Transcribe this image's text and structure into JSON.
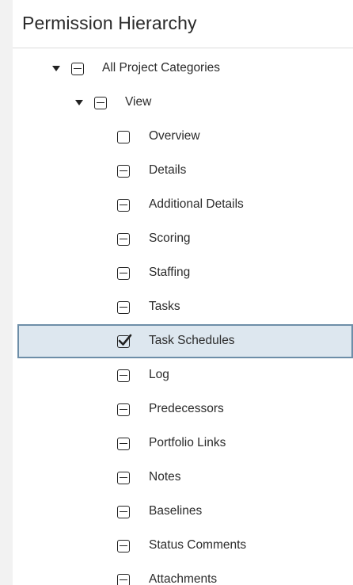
{
  "header": {
    "title": "Permission Hierarchy"
  },
  "tree": {
    "root": {
      "label": "All Project Categories",
      "state": "partial",
      "expanded": true
    },
    "group": {
      "label": "View",
      "state": "partial",
      "expanded": true
    },
    "items": [
      {
        "label": "Overview",
        "state": "unchecked"
      },
      {
        "label": "Details",
        "state": "partial"
      },
      {
        "label": "Additional Details",
        "state": "partial"
      },
      {
        "label": "Scoring",
        "state": "partial"
      },
      {
        "label": "Staffing",
        "state": "partial"
      },
      {
        "label": "Tasks",
        "state": "partial"
      },
      {
        "label": "Task Schedules",
        "state": "checked",
        "selected": true
      },
      {
        "label": "Log",
        "state": "partial"
      },
      {
        "label": "Predecessors",
        "state": "partial"
      },
      {
        "label": "Portfolio Links",
        "state": "partial"
      },
      {
        "label": "Notes",
        "state": "partial"
      },
      {
        "label": "Baselines",
        "state": "partial"
      },
      {
        "label": "Status Comments",
        "state": "partial"
      },
      {
        "label": "Attachments",
        "state": "partial"
      }
    ]
  },
  "colors": {
    "selected_bg": "#dde7ef",
    "selected_border": "#6d8ea8",
    "icon": "#222222"
  }
}
